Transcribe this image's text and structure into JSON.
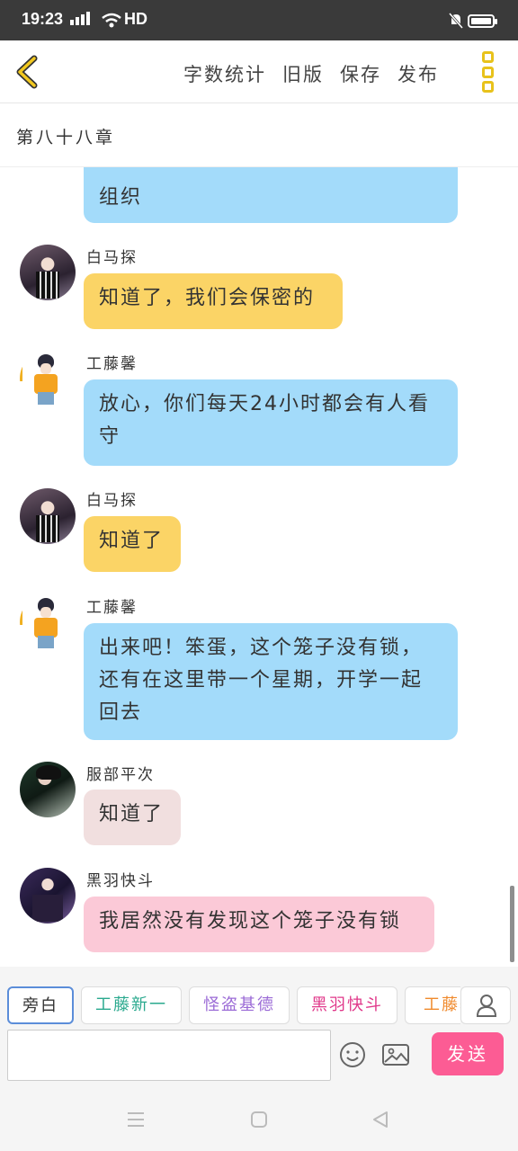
{
  "status": {
    "time": "19:23",
    "network": "4G",
    "hd": "HD"
  },
  "toolbar": {
    "menu": [
      "字数统计",
      "旧版",
      "保存",
      "发布"
    ]
  },
  "chapter": {
    "title": "第八十八章"
  },
  "messages": [
    {
      "text": "组织"
    },
    {
      "speaker": "白马探",
      "text": "知道了，我们会保密的"
    },
    {
      "speaker": "工藤馨",
      "text": "放心，你们每天24小时都会有人看守"
    },
    {
      "speaker": "白马探",
      "text": "知道了"
    },
    {
      "speaker": "工藤馨",
      "text": "出来吧！笨蛋，这个笼子没有锁，还有在这里带一个星期，开学一起回去"
    },
    {
      "speaker": "服部平次",
      "text": "知道了"
    },
    {
      "speaker": "黑羽快斗",
      "text": "我居然没有发现这个笼子没有锁"
    }
  ],
  "characters": [
    "旁白",
    "工藤新一",
    "怪盗基德",
    "黑羽快斗",
    "工藤馨"
  ],
  "composer": {
    "placeholder": "",
    "send_label": "发送"
  },
  "colors": {
    "accent": "#e8c21b",
    "send": "#fc5c94",
    "bubble_blue": "#a3dbfa",
    "bubble_yellow": "#fbd466",
    "bubble_gray": "#f1dfdf",
    "bubble_pink": "#fbc9d7"
  }
}
